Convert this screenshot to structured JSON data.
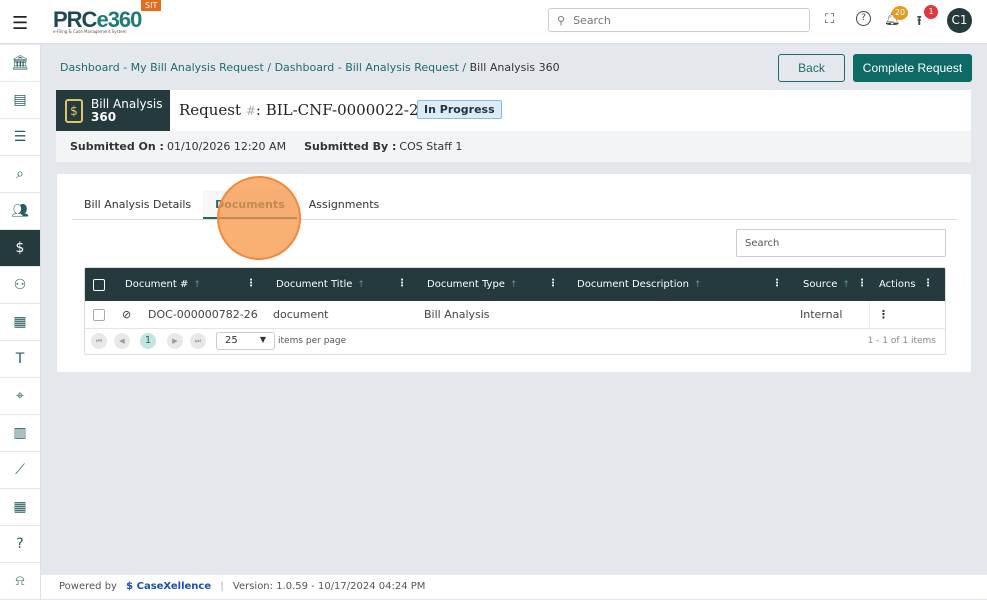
{
  "topbar": {
    "logo": "PRCe360",
    "logo_tagline": "e-Filing & Case Management System",
    "env_badge": "SIT",
    "search_placeholder": "Search",
    "notifications_count": "20",
    "uploads_count": "1",
    "avatar_initials": "C1"
  },
  "sidebar": {
    "items": [
      "bank-icon",
      "document-icon",
      "message-icon",
      "document-search-icon",
      "users-icon",
      "bill-document-icon",
      "org-chart-icon",
      "building-icon",
      "text-box-icon",
      "scan-search-icon",
      "book-icon",
      "chart-icon",
      "calendar-icon",
      "help-doc-icon",
      "alarm-icon"
    ],
    "active_index": 5
  },
  "breadcrumb": {
    "items": [
      "Dashboard - My Bill Analysis Request",
      "Dashboard - Bill Analysis Request"
    ],
    "separator": " / ",
    "current": "Bill Analysis 360"
  },
  "actions": {
    "back": "Back",
    "complete": "Complete Request"
  },
  "header": {
    "module_line1": "Bill Analysis",
    "module_line2": "360",
    "request_label": "Request ",
    "hash": "#",
    "request_id": ": BIL-CNF-0000022-26",
    "status": "In Progress",
    "submitted_on_label": "Submitted On :",
    "submitted_on": "01/10/2026 12:20 AM",
    "submitted_by_label": "Submitted By :",
    "submitted_by": "COS Staff 1"
  },
  "tabs": [
    "Bill Analysis Details",
    "Documents",
    "Assignments"
  ],
  "active_tab": 1,
  "grid": {
    "search_placeholder": "Search",
    "columns": [
      "Document #",
      "Document Title",
      "Document Type",
      "Document Description",
      "Source",
      "Actions"
    ],
    "rows": [
      {
        "doc_no": "DOC-000000782-26",
        "title": "document",
        "type": "Bill Analysis",
        "description": "",
        "source": "Internal"
      }
    ],
    "pager": {
      "current_page": "1",
      "page_size": "25",
      "items_per_page_label": "items per page",
      "summary": "1 - 1 of 1 items"
    }
  },
  "footer": {
    "powered_by": "Powered by",
    "brand": "CaseXellence",
    "separator": "|",
    "version": "Version: 1.0.59 - 10/17/2024 04:24 PM"
  }
}
